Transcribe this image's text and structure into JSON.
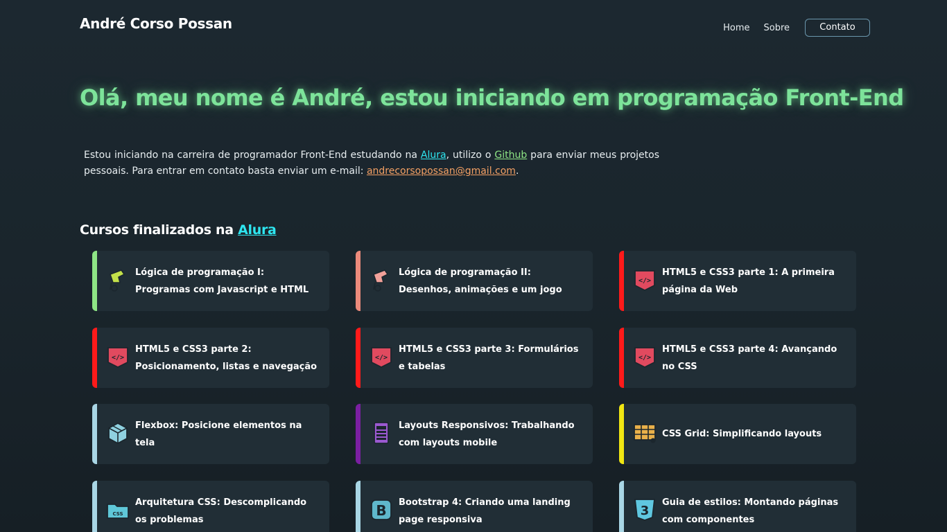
{
  "header": {
    "brand": "André Corso Possan",
    "nav": {
      "home": "Home",
      "about": "Sobre",
      "contact": "Contato"
    }
  },
  "hero": {
    "title": "Olá, meu nome é André, estou iniciando em programação Front-End"
  },
  "intro": {
    "text_1": "Estou iniciando na carreira de programador Front-End estudando na ",
    "alura_link": "Alura",
    "text_2": ", utilizo o ",
    "github_link": "Github",
    "text_3": " para enviar meus projetos pessoais. Para entrar em contato basta enviar um e-mail: ",
    "email_link": "andrecorsopossan@gmail.com",
    "text_4": "."
  },
  "courses_section": {
    "title_prefix": "Cursos finalizados na ",
    "title_link": "Alura"
  },
  "courses": [
    {
      "title": "Lógica de programação I: Programas com Javascript e HTML",
      "accent": "#8ee585",
      "icon": "logic-flag-icon",
      "icon_color": "#c3e04a"
    },
    {
      "title": "Lógica de programação II: Desenhos, animações e um jogo",
      "accent": "#ec8a7b",
      "icon": "logic-flag-icon",
      "icon_color": "#f2a19a"
    },
    {
      "title": "HTML5 e CSS3 parte 1: A primeira página da Web",
      "accent": "#ff1a1a",
      "icon": "html-code-icon",
      "icon_color": "#e14a5f"
    },
    {
      "title": "HTML5 e CSS3 parte 2: Posicionamento, listas e navegação",
      "accent": "#ff1a1a",
      "icon": "html-code-icon",
      "icon_color": "#e14a5f"
    },
    {
      "title": "HTML5 e CSS3 parte 3: Formulários e tabelas",
      "accent": "#ff1a1a",
      "icon": "html-code-icon",
      "icon_color": "#e14a5f"
    },
    {
      "title": "HTML5 e CSS3 parte 4: Avançando no CSS",
      "accent": "#ff1a1a",
      "icon": "html-code-icon",
      "icon_color": "#e14a5f"
    },
    {
      "title": "Flexbox: Posicione elementos na tela",
      "accent": "#a9d6e5",
      "icon": "flexbox-box-icon",
      "icon_color": "#8fd1e0"
    },
    {
      "title": "Layouts Responsivos: Trabalhando com layouts mobile",
      "accent": "#7b1fa2",
      "icon": "mobile-layout-icon",
      "icon_color": "#9b59d0"
    },
    {
      "title": "CSS Grid: Simplificando layouts",
      "accent": "#f0e612",
      "icon": "css-grid-icon",
      "icon_color": "#e8b04a"
    },
    {
      "title": "Arquitetura CSS: Descomplicando os problemas",
      "accent": "#a9d6e5",
      "icon": "css-folder-icon",
      "icon_color": "#5fc7d8"
    },
    {
      "title": "Bootstrap 4: Criando uma landing page responsiva",
      "accent": "#a9d6e5",
      "icon": "bootstrap-icon",
      "icon_color": "#5fb8cc"
    },
    {
      "title": "Guia de estilos: Montando páginas com componentes",
      "accent": "#a9d6e5",
      "icon": "css3-shield-icon",
      "icon_color": "#5fc7e0"
    }
  ]
}
